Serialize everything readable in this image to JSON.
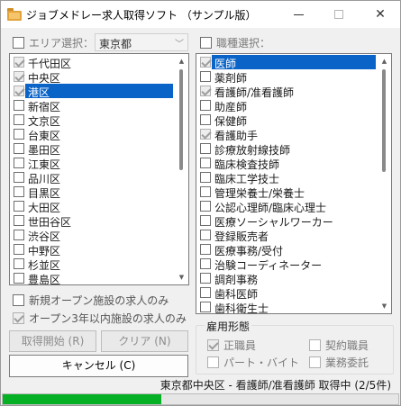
{
  "window": {
    "title": "ジョブメドレー求人取得ソフト （サンプル版）"
  },
  "area": {
    "checkbox_label": "エリア選択：",
    "selected_value": "東京都",
    "items": [
      {
        "label": "千代田区",
        "checked": true,
        "selected": false
      },
      {
        "label": "中央区",
        "checked": true,
        "selected": false
      },
      {
        "label": "港区",
        "checked": true,
        "selected": true
      },
      {
        "label": "新宿区",
        "checked": false,
        "selected": false
      },
      {
        "label": "文京区",
        "checked": false,
        "selected": false
      },
      {
        "label": "台東区",
        "checked": false,
        "selected": false
      },
      {
        "label": "墨田区",
        "checked": false,
        "selected": false
      },
      {
        "label": "江東区",
        "checked": false,
        "selected": false
      },
      {
        "label": "品川区",
        "checked": false,
        "selected": false
      },
      {
        "label": "目黒区",
        "checked": false,
        "selected": false
      },
      {
        "label": "大田区",
        "checked": false,
        "selected": false
      },
      {
        "label": "世田谷区",
        "checked": false,
        "selected": false
      },
      {
        "label": "渋谷区",
        "checked": false,
        "selected": false
      },
      {
        "label": "中野区",
        "checked": false,
        "selected": false
      },
      {
        "label": "杉並区",
        "checked": false,
        "selected": false
      },
      {
        "label": "豊島区",
        "checked": false,
        "selected": false
      }
    ]
  },
  "job": {
    "checkbox_label": "職種選択：",
    "items": [
      {
        "label": "医師",
        "checked": true,
        "selected": true
      },
      {
        "label": "薬剤師",
        "checked": false,
        "selected": false
      },
      {
        "label": "看護師/准看護師",
        "checked": true,
        "selected": false
      },
      {
        "label": "助産師",
        "checked": false,
        "selected": false
      },
      {
        "label": "保健師",
        "checked": false,
        "selected": false
      },
      {
        "label": "看護助手",
        "checked": true,
        "selected": false
      },
      {
        "label": "診療放射線技師",
        "checked": false,
        "selected": false
      },
      {
        "label": "臨床検査技師",
        "checked": false,
        "selected": false
      },
      {
        "label": "臨床工学技士",
        "checked": false,
        "selected": false
      },
      {
        "label": "管理栄養士/栄養士",
        "checked": false,
        "selected": false
      },
      {
        "label": "公認心理師/臨床心理士",
        "checked": false,
        "selected": false
      },
      {
        "label": "医療ソーシャルワーカー",
        "checked": false,
        "selected": false
      },
      {
        "label": "登録販売者",
        "checked": false,
        "selected": false
      },
      {
        "label": "医療事務/受付",
        "checked": false,
        "selected": false
      },
      {
        "label": "治験コーディネーター",
        "checked": false,
        "selected": false
      },
      {
        "label": "調剤事務",
        "checked": false,
        "selected": false
      },
      {
        "label": "歯科医師",
        "checked": false,
        "selected": false
      },
      {
        "label": "歯科衛生士",
        "checked": false,
        "selected": false
      }
    ]
  },
  "options": {
    "new_open": "新規オープン施設の求人のみ",
    "within_3yrs": "オープン3年以内施設の求人のみ"
  },
  "buttons": {
    "start": "取得開始 (R)",
    "clear": "クリア (N)",
    "cancel": "キャンセル (C)"
  },
  "employment": {
    "title": "雇用形態",
    "fulltime": "正職員",
    "contract": "契約職員",
    "parttime": "パート・バイト",
    "outsourcing": "業務委託"
  },
  "status": {
    "text": "東京都中央区 - 看護師/准看護師 取得中 (2/5件)"
  },
  "progress": {
    "value": 0.4
  },
  "colors": {
    "selection": "#0a64c8",
    "progress": "#06b025"
  }
}
